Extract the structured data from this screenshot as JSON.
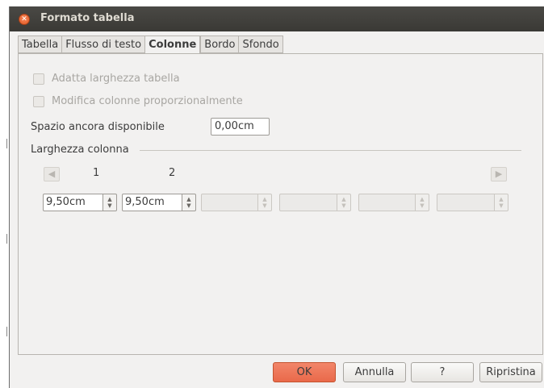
{
  "window": {
    "title": "Formato tabella"
  },
  "tabs": [
    {
      "label": "Tabella",
      "active": false
    },
    {
      "label": "Flusso di testo",
      "active": false
    },
    {
      "label": "Colonne",
      "active": true
    },
    {
      "label": "Bordo",
      "active": false
    },
    {
      "label": "Sfondo",
      "active": false
    }
  ],
  "options": {
    "adapt_width": {
      "label": "Adatta larghezza tabella",
      "checked": false,
      "enabled": false
    },
    "modify_proportional": {
      "label": "Modifica colonne proporzionalmente",
      "checked": false,
      "enabled": false
    }
  },
  "remaining_space": {
    "label": "Spazio ancora disponibile",
    "value": "0,00cm"
  },
  "column_width": {
    "section_label": "Larghezza colonna",
    "left_arrow_icon": "arrow-left-icon",
    "right_arrow_icon": "arrow-right-icon",
    "column_numbers": [
      "1",
      "2"
    ],
    "fields": [
      {
        "value": "9,50cm",
        "enabled": true
      },
      {
        "value": "9,50cm",
        "enabled": true
      },
      {
        "value": "",
        "enabled": false
      },
      {
        "value": "",
        "enabled": false
      },
      {
        "value": "",
        "enabled": false
      },
      {
        "value": "",
        "enabled": false
      }
    ]
  },
  "buttons": {
    "ok": "OK",
    "cancel": "Annulla",
    "help": "?",
    "reset": "Ripristina"
  },
  "colors": {
    "accent": "#e9694a",
    "titlebar": "#3c3b37"
  }
}
